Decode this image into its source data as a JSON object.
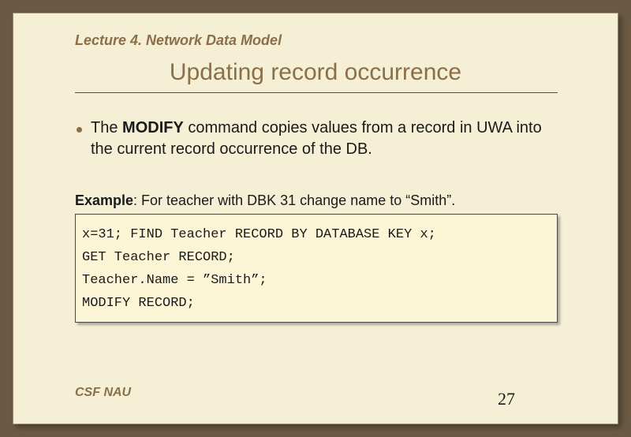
{
  "header": {
    "lecture": "Lecture 4. Network Data Model"
  },
  "title": "Updating record occurrence",
  "body": {
    "text_before_bold": "The ",
    "bold_word": "MODIFY",
    "text_after_bold": " command copies values from a record in UWA into the current record occurrence of the DB."
  },
  "example": {
    "label_bold": "Example",
    "label_rest": ": For teacher with DBK 31 change name to “Smith”."
  },
  "code": {
    "line1": "x=31; FIND Teacher RECORD BY DATABASE KEY x;",
    "line2": "GET Teacher RECORD;",
    "line3": "Teacher.Name = ”Smith”;",
    "line4": "MODIFY RECORD;"
  },
  "footer": {
    "org": "CSF NAU",
    "page": "27"
  }
}
